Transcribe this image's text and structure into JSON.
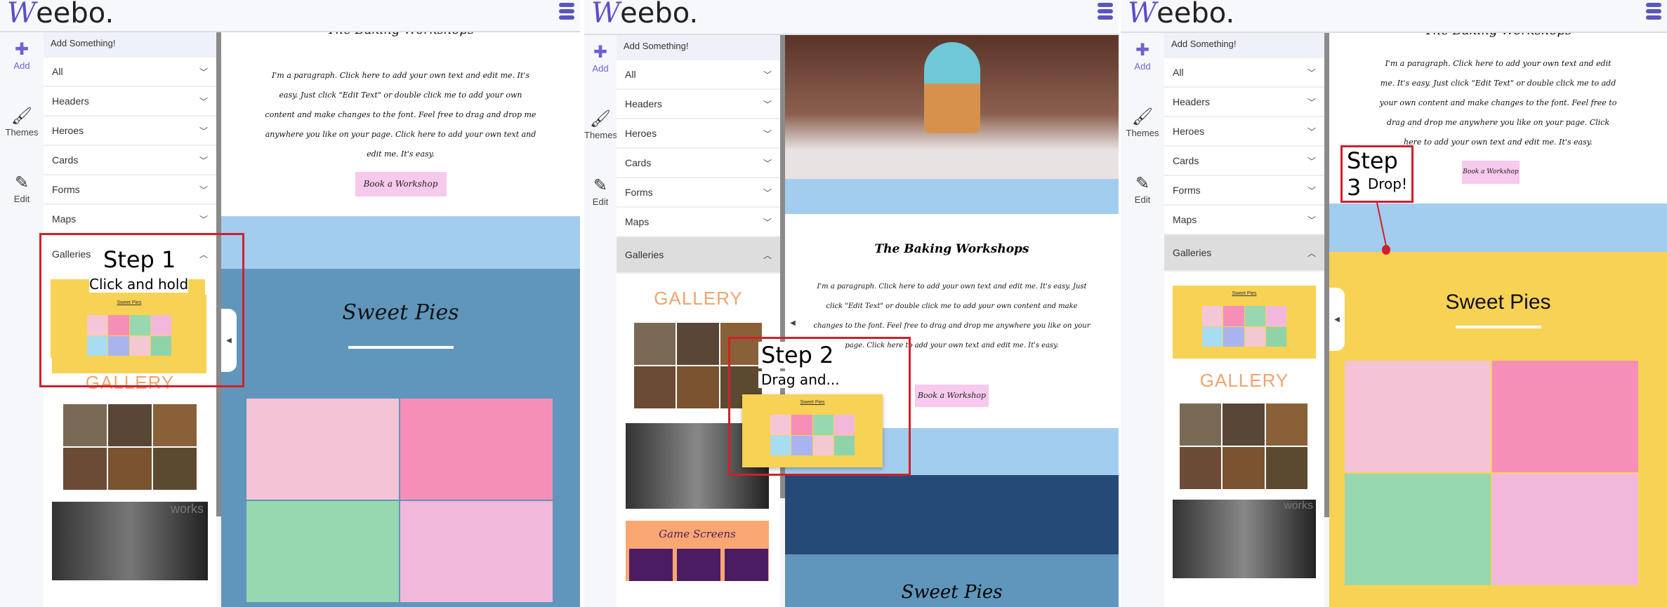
{
  "app": {
    "logo": "Weebo.",
    "rail": [
      {
        "label": "Add",
        "icon": "plus-icon"
      },
      {
        "label": "Themes",
        "icon": "brush-icon"
      },
      {
        "label": "Edit",
        "icon": "edit-icon"
      }
    ]
  },
  "sidebar": {
    "title": "Add Something!",
    "categories": [
      "All",
      "Headers",
      "Heroes",
      "Cards",
      "Forms",
      "Maps",
      "Galleries"
    ],
    "gallery_preview_title": "Sweet Pies",
    "gallery_label": "GALLERY",
    "game_screens": "Game Screens",
    "works_label": "works"
  },
  "canvas": {
    "heading": "The Baking Workshops",
    "paragraph": "I'm a paragraph. Click here to add your own text and edit me. It's easy. Just click \"Edit Text\" or double click me to add your own content and make changes to the font. Feel free to drag and drop me anywhere you like on your page. Click here to add your own text and edit me. It's easy.",
    "button": "Book a Workshop",
    "section_title": "Sweet Pies"
  },
  "steps": [
    {
      "step": "Step 1",
      "caption": "Click and hold"
    },
    {
      "step": "Step 2",
      "caption": "Drag and..."
    },
    {
      "step": "Step 3",
      "caption": "Drop!"
    }
  ],
  "colors": {
    "brand": "#5a4fc8",
    "highlight": "#d0202a",
    "light_blue": "#a3cdef",
    "steel_blue": "#6096bb",
    "navy": "#264a78",
    "yellow": "#f8d254",
    "button_pink": "#f7c9ec",
    "gallery_orange": "#f0a46e"
  }
}
